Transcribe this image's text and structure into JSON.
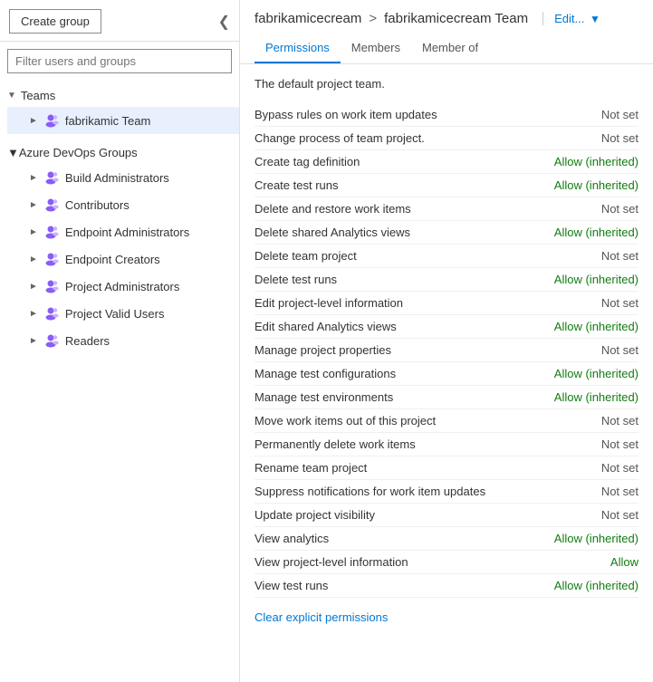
{
  "sidebar": {
    "create_group_label": "Create group",
    "filter_placeholder": "Filter users and groups",
    "collapse_icon": "❮",
    "teams_section": {
      "label": "Teams",
      "items": [
        {
          "name": "fabrikamic Team",
          "active": true
        }
      ]
    },
    "azure_groups_section": {
      "label": "Azure DevOps Groups",
      "items": [
        {
          "name": "Build Administrators"
        },
        {
          "name": "Contributors"
        },
        {
          "name": "Endpoint Administrators"
        },
        {
          "name": "Endpoint Creators"
        },
        {
          "name": "Project Administrators"
        },
        {
          "name": "Project Valid Users"
        },
        {
          "name": "Readers"
        }
      ]
    }
  },
  "main": {
    "breadcrumb": {
      "org": "fabrikamicecream",
      "separator": ">",
      "team": "fabrikamicecream Team",
      "edit_label": "Edit..."
    },
    "tabs": [
      {
        "label": "Permissions",
        "active": true
      },
      {
        "label": "Members",
        "active": false
      },
      {
        "label": "Member of",
        "active": false
      }
    ],
    "default_text": "The default project team.",
    "permissions": [
      {
        "name": "Bypass rules on work item updates",
        "value": "Not set",
        "type": "not-set"
      },
      {
        "name": "Change process of team project.",
        "value": "Not set",
        "type": "not-set"
      },
      {
        "name": "Create tag definition",
        "value": "Allow (inherited)",
        "type": "allow"
      },
      {
        "name": "Create test runs",
        "value": "Allow (inherited)",
        "type": "allow"
      },
      {
        "name": "Delete and restore work items",
        "value": "Not set",
        "type": "not-set"
      },
      {
        "name": "Delete shared Analytics views",
        "value": "Allow (inherited)",
        "type": "allow"
      },
      {
        "name": "Delete team project",
        "value": "Not set",
        "type": "not-set"
      },
      {
        "name": "Delete test runs",
        "value": "Allow (inherited)",
        "type": "allow"
      },
      {
        "name": "Edit project-level information",
        "value": "Not set",
        "type": "not-set"
      },
      {
        "name": "Edit shared Analytics views",
        "value": "Allow (inherited)",
        "type": "allow"
      },
      {
        "name": "Manage project properties",
        "value": "Not set",
        "type": "not-set"
      },
      {
        "name": "Manage test configurations",
        "value": "Allow (inherited)",
        "type": "allow"
      },
      {
        "name": "Manage test environments",
        "value": "Allow (inherited)",
        "type": "allow"
      },
      {
        "name": "Move work items out of this project",
        "value": "Not set",
        "type": "not-set"
      },
      {
        "name": "Permanently delete work items",
        "value": "Not set",
        "type": "not-set"
      },
      {
        "name": "Rename team project",
        "value": "Not set",
        "type": "not-set"
      },
      {
        "name": "Suppress notifications for work item updates",
        "value": "Not set",
        "type": "not-set"
      },
      {
        "name": "Update project visibility",
        "value": "Not set",
        "type": "not-set"
      },
      {
        "name": "View analytics",
        "value": "Allow (inherited)",
        "type": "allow"
      },
      {
        "name": "View project-level information",
        "value": "Allow",
        "type": "allow"
      },
      {
        "name": "View test runs",
        "value": "Allow (inherited)",
        "type": "allow"
      }
    ],
    "clear_link_label": "Clear explicit permissions"
  }
}
